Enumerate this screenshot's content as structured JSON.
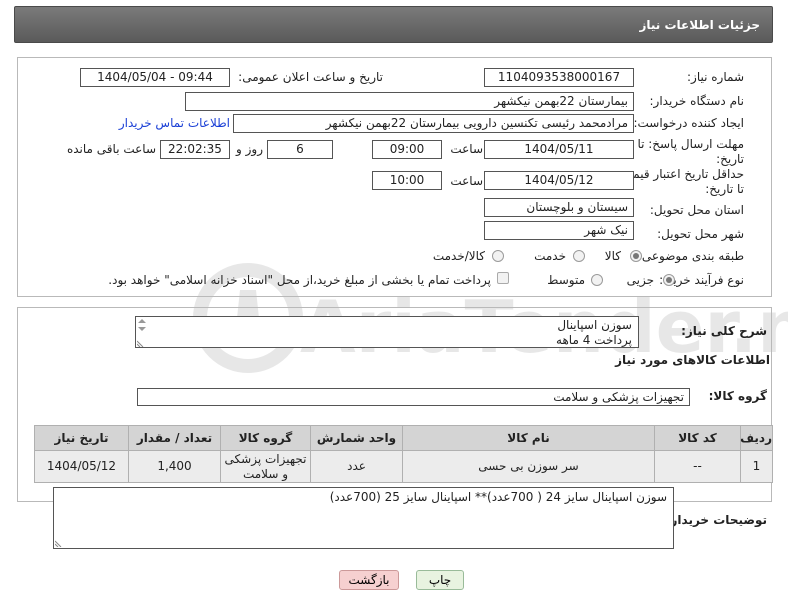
{
  "header": {
    "title": "جزئیات اطلاعات نیاز"
  },
  "fields": {
    "need_number_label": "شماره نیاز:",
    "need_number": "1104093538000167",
    "announce_label": "تاریخ و ساعت اعلان عمومی:",
    "announce_value": "1404/05/04 - 09:44",
    "buyer_org_label": "نام دستگاه خریدار:",
    "buyer_org": "بیمارستان 22بهمن نیکشهر",
    "creator_label": "ایجاد کننده درخواست:",
    "creator": "مرادمحمد رئیسی تکنسین دارویی بیمارستان 22بهمن نیکشهر",
    "contact_link": "اطلاعات تماس خریدار",
    "deadline_label": "مهلت ارسال پاسخ: تا تاریخ:",
    "deadline_date": "1404/05/11",
    "hour_label": "ساعت",
    "deadline_time": "09:00",
    "days_value": "6",
    "days_label": "روز و",
    "remaining_time": "22:02:35",
    "remaining_label": "ساعت باقی مانده",
    "price_validity_label": "حداقل تاریخ اعتبار قیمت: تا تاریخ:",
    "price_validity_date": "1404/05/12",
    "price_validity_time": "10:00",
    "province_label": "استان محل تحویل:",
    "province": "سیستان و بلوچستان",
    "city_label": "شهر محل تحویل:",
    "city": "نیک شهر",
    "category_label": "طبقه بندی موضوعی:",
    "category_options": [
      "کالا",
      "خدمت",
      "کالا/خدمت"
    ],
    "process_label": "نوع فرآیند خرید :",
    "process_options": [
      "جزیی",
      "متوسط"
    ],
    "payment_note": "پرداخت تمام یا بخشی از مبلغ خرید،از محل \"اسناد خزانه اسلامی\" خواهد بود."
  },
  "description": {
    "label": "شرح کلی نیاز:",
    "line1": "سوزن اسپاینال",
    "line2": "پرداخت 4 ماهه"
  },
  "goods": {
    "section_title": "اطلاعات کالاهای مورد نیاز",
    "group_label": "گروه کالا:",
    "group_value": "تجهیزات پزشکی و سلامت",
    "columns": [
      "ردیف",
      "کد کالا",
      "نام کالا",
      "واحد شمارش",
      "گروه کالا",
      "تعداد / مقدار",
      "تاریخ نیاز"
    ],
    "rows": [
      [
        "1",
        "--",
        "سر سوزن بی حسی",
        "عدد",
        "تجهیزات پزشکی و سلامت",
        "1,400",
        "1404/05/12"
      ]
    ]
  },
  "buyer_notes": {
    "label": "توضیحات خریدار:",
    "text": "سوزن اسپاینال سایز 24 ( 700عدد)** اسپاینال سایز 25 (700عدد)"
  },
  "buttons": {
    "print": "چاپ",
    "back": "بازگشت"
  },
  "watermark": {
    "text": "AriaTender.neT"
  },
  "colors": {
    "header": "#666666",
    "link": "#1a3fd6",
    "back_button": "#f6d0d0",
    "print_button": "#e8f3e0"
  }
}
